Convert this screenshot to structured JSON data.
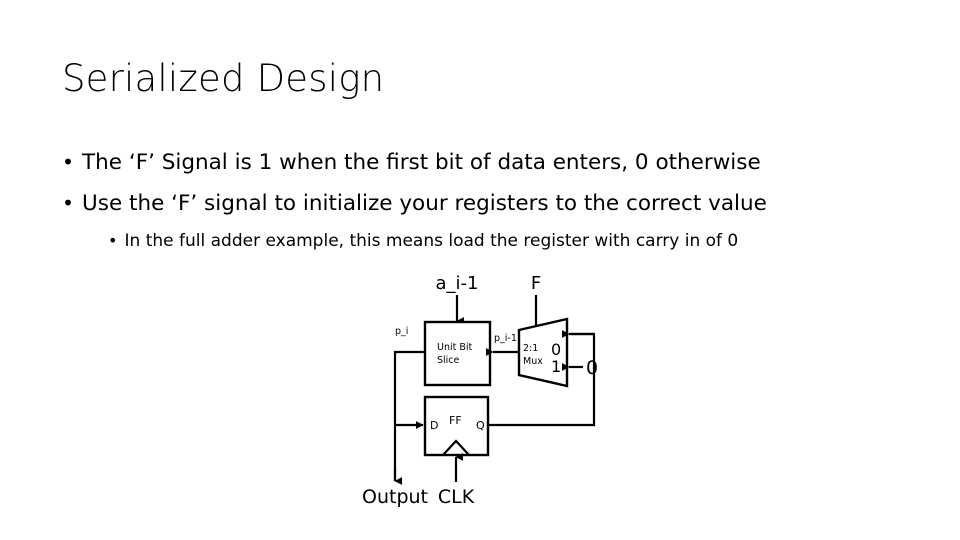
{
  "slide": {
    "title": "Serialized Design",
    "bullets": [
      {
        "level": 1,
        "marker": "•",
        "text": "The ‘F’ Signal is 1 when the first bit of data enters, 0 otherwise"
      },
      {
        "level": 1,
        "marker": "•",
        "text": "Use the ‘F’ signal to initialize your registers to the correct value"
      },
      {
        "level": 2,
        "marker": "•",
        "text": "In the full adder example, this means load the register with carry in of 0"
      }
    ]
  },
  "diagram": {
    "name": "serialized-datapath-block-diagram",
    "labels": {
      "input_a": "a_i-1",
      "input_f": "F",
      "input_p": "p_i",
      "mux_to_slice": "p_i-1",
      "unit_block_line1": "Unit Bit",
      "unit_block_line2": "Slice",
      "mux_line1": "2:1",
      "mux_line2": "Mux",
      "mux_port_0": "0",
      "mux_port_1": "1",
      "const_zero": "0",
      "ff_d": "D",
      "ff_name": "FF",
      "ff_q": "Q",
      "clock": "CLK",
      "output": "Output"
    },
    "colors": {
      "line": "#000000",
      "fill": "#ffffff",
      "text": "#000000",
      "background": "#ffffff"
    }
  }
}
